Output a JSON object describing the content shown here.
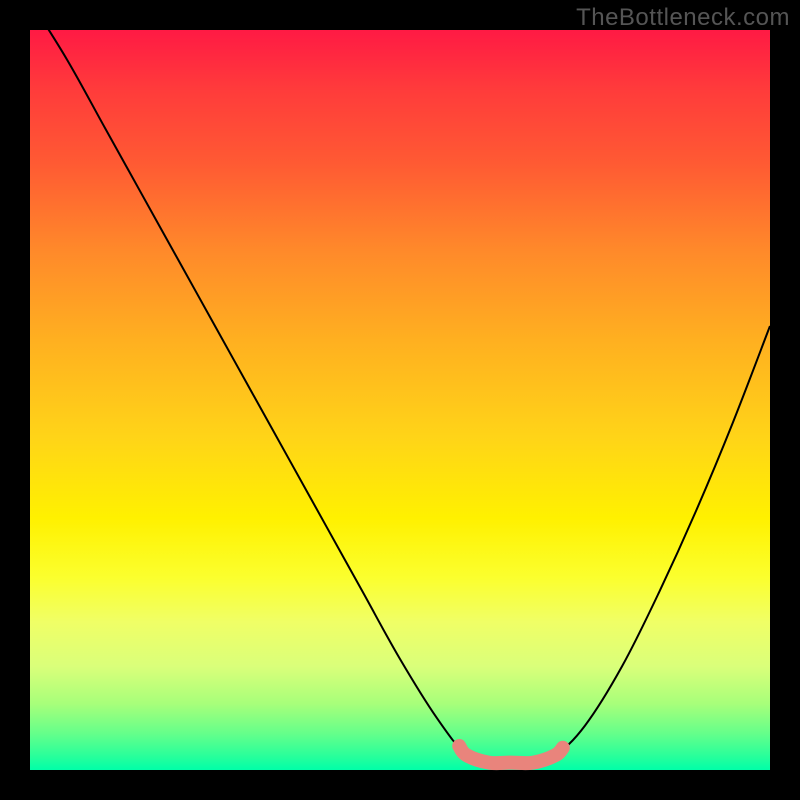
{
  "watermark": "TheBottleneck.com",
  "colors": {
    "frame_background": "#000000",
    "watermark_text": "#555555",
    "curve_stroke": "#000000",
    "highlight_stroke": "#e9847c",
    "gradient_top": "#ff1a44",
    "gradient_bottom": "#00ffa8"
  },
  "chart_data": {
    "type": "line",
    "title": "",
    "xlabel": "",
    "ylabel": "",
    "xlim": [
      0,
      100
    ],
    "ylim": [
      0,
      100
    ],
    "series": [
      {
        "name": "bottleneck-curve",
        "x": [
          0,
          5,
          10,
          15,
          20,
          25,
          30,
          35,
          40,
          45,
          50,
          55,
          59,
          62,
          65,
          68,
          71,
          75,
          80,
          85,
          90,
          95,
          100
        ],
        "values": [
          104,
          96,
          87,
          78,
          69,
          60,
          51,
          42,
          33,
          24,
          15,
          7,
          2,
          1,
          1,
          1,
          2,
          6,
          14,
          24,
          35,
          47,
          60
        ]
      }
    ],
    "highlight_region": {
      "x_start": 58,
      "x_end": 72
    },
    "background": "heatmap-gradient-vertical"
  }
}
